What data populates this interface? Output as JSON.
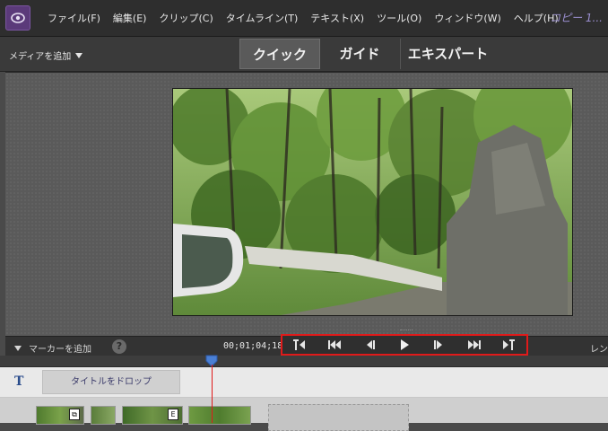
{
  "menu": {
    "items": [
      "ファイル(F)",
      "編集(E)",
      "クリップ(C)",
      "タイムライン(T)",
      "テキスト(X)",
      "ツール(O)",
      "ウィンドウ(W)",
      "ヘルプ(H)"
    ],
    "app_title": "コピー 1..."
  },
  "toolbar": {
    "add_media_label": "メディアを追加",
    "modes": [
      "クイック",
      "ガイド",
      "エキスパート"
    ],
    "active_mode": "クイック"
  },
  "controls": {
    "add_marker_label": "マーカーを追加",
    "help_glyph": "?",
    "timecode": "00;01;04;18",
    "render_label": "レンダ"
  },
  "transport": {
    "buttons": [
      "go-to-in-point",
      "go-to-previous-edit",
      "step-back",
      "play",
      "step-forward",
      "go-to-next-edit",
      "go-to-out-point"
    ]
  },
  "timeline": {
    "title_track_icon": "T",
    "drop_title_label": "タイトルをドロップ"
  },
  "colors": {
    "highlight_border": "#e01a1a",
    "playhead": "#4a7fd4",
    "accent_purple": "#5b3a7a"
  }
}
